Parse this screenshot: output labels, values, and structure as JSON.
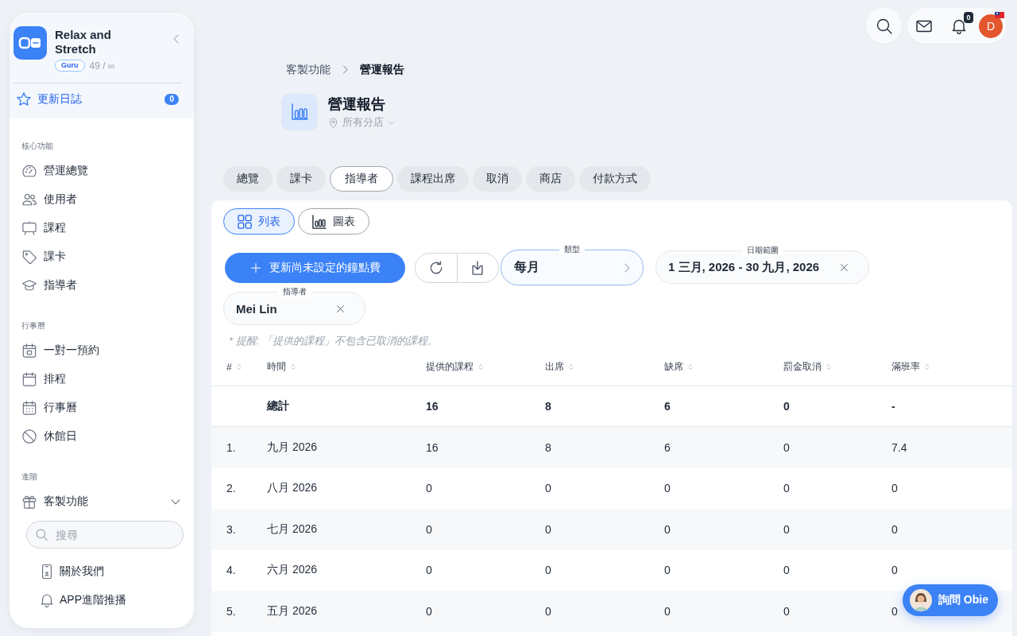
{
  "sidebar": {
    "brand": {
      "name": "Relax and Stretch",
      "plan": "Guru",
      "usage": "49 / ∞"
    },
    "changelog": {
      "label": "更新日誌",
      "count": "0"
    },
    "sections": [
      {
        "title": "核心功能",
        "items": [
          {
            "label": "營運總覽"
          },
          {
            "label": "使用者"
          },
          {
            "label": "課程"
          },
          {
            "label": "課卡"
          },
          {
            "label": "指導者"
          }
        ]
      },
      {
        "title": "行事曆",
        "items": [
          {
            "label": "一對一預約"
          },
          {
            "label": "排程"
          },
          {
            "label": "行事曆"
          },
          {
            "label": "休館日"
          }
        ]
      },
      {
        "title": "進階",
        "items": [
          {
            "label": "客製功能",
            "expanded": true,
            "search": {
              "placeholder": "搜尋"
            },
            "children": [
              {
                "label": "關於我們"
              },
              {
                "label": "APP進階推播"
              }
            ]
          }
        ]
      }
    ]
  },
  "header": {
    "notification_count": "0",
    "avatar_initial": "D"
  },
  "breadcrumb": [
    {
      "label": "客製功能"
    },
    {
      "label": "營運報告"
    }
  ],
  "page": {
    "title": "營運報告",
    "location": "所有分店"
  },
  "tabs": [
    {
      "label": "總覽",
      "selected": false
    },
    {
      "label": "課卡",
      "selected": false
    },
    {
      "label": "指導者",
      "selected": true
    },
    {
      "label": "課程出席",
      "selected": false
    },
    {
      "label": "取消",
      "selected": false
    },
    {
      "label": "商店",
      "selected": false
    },
    {
      "label": "付款方式",
      "selected": false
    }
  ],
  "view_toggle": [
    {
      "label": "列表",
      "selected": true
    },
    {
      "label": "圖表",
      "selected": false
    }
  ],
  "filters": {
    "action_button": "更新尚未設定的鐘點費",
    "fields": [
      {
        "kind": "select",
        "label": "類型",
        "value": "每月",
        "focused": true
      },
      {
        "kind": "clearable",
        "label": "日期範圍",
        "value": "1 三月, 2026 - 30 九月, 2026",
        "focused": false
      },
      {
        "kind": "clearable",
        "label": "指導者",
        "value": "Mei Lin",
        "focused": false
      }
    ]
  },
  "note": "* 提醒: 「提供的課程」不包含已取消的課程。",
  "table": {
    "columns": [
      "#",
      "時間",
      "提供的課程",
      "出席",
      "缺席",
      "罰金取消",
      "滿班率"
    ],
    "total": {
      "label": "總計",
      "values": [
        "16",
        "8",
        "6",
        "0",
        "-"
      ]
    },
    "rows": [
      [
        "1.",
        "九月 2026",
        "16",
        "8",
        "6",
        "0",
        "7.4"
      ],
      [
        "2.",
        "八月 2026",
        "0",
        "0",
        "0",
        "0",
        "0"
      ],
      [
        "3.",
        "七月 2026",
        "0",
        "0",
        "0",
        "0",
        "0"
      ],
      [
        "4.",
        "六月 2026",
        "0",
        "0",
        "0",
        "0",
        "0"
      ],
      [
        "5.",
        "五月 2026",
        "0",
        "0",
        "0",
        "0",
        "0"
      ]
    ]
  },
  "assistant_button": {
    "label": "詢問 Obie"
  }
}
